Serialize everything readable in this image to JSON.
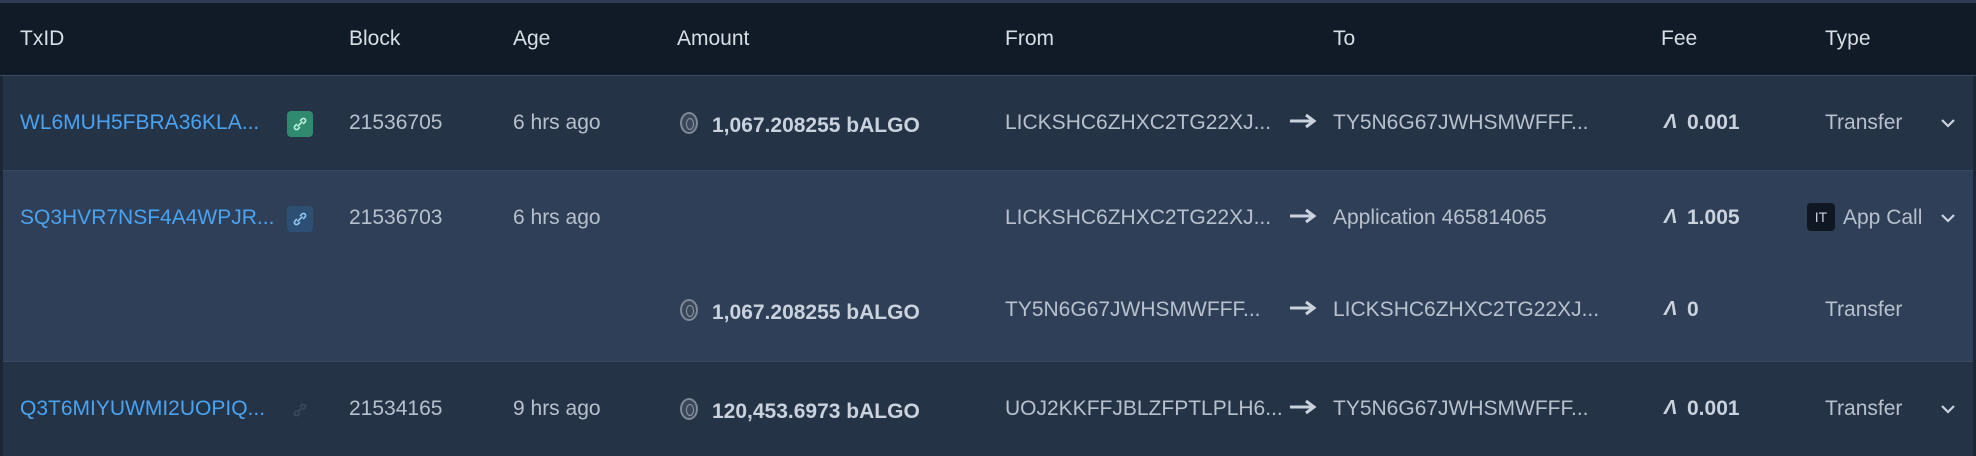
{
  "headers": [
    "TxID",
    "Block",
    "Age",
    "Amount",
    "From",
    "To",
    "Fee",
    "Type"
  ],
  "rows": [
    {
      "txid": "WL6MUH5FBRA36KLA...",
      "block": "21536705",
      "age": "6 hrs ago",
      "amount": "1,067.208255 bALGO",
      "from": "LICKSHC6ZHXC2TG22XJ...",
      "to": "TY5N6G67JWHSMWFFF...",
      "fee": "0.001",
      "type": "Transfer",
      "link_badge": "linked"
    },
    {
      "txid": "SQ3HVR7NSF4A4WPJR...",
      "block": "21536703",
      "age": "6 hrs ago",
      "from": "LICKSHC6ZHXC2TG22XJ...",
      "to": "Application 465814065",
      "fee": "1.005",
      "type": "App Call",
      "type_badge": "IT",
      "link_badge": "linked",
      "inner": {
        "amount": "1,067.208255 bALGO",
        "from": "TY5N6G67JWHSMWFFF...",
        "to": "LICKSHC6ZHXC2TG22XJ...",
        "fee": "0",
        "type": "Transfer"
      }
    },
    {
      "txid": "Q3T6MIYUWMI2UOPIQ...",
      "block": "21534165",
      "age": "9 hrs ago",
      "amount": "120,453.6973 bALGO",
      "from": "UOJ2KKFFJBLZFPTLPLH6...",
      "to": "TY5N6G67JWHSMWFFF...",
      "fee": "0.001",
      "type": "Transfer",
      "link_badge": "faded"
    }
  ],
  "colors": {
    "link": "#4aa3f0",
    "badge_green": "#2f8a6e",
    "badge_blue": "#2c4f73"
  },
  "icons": {
    "coin": "coin-icon",
    "arrow": "arrow-right-icon",
    "algo": "algo-icon",
    "chevron": "chevron-down-icon",
    "link": "link-icon"
  }
}
